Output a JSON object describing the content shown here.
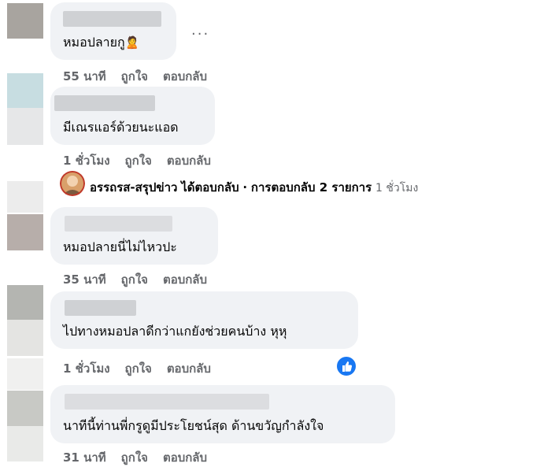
{
  "comments": [
    {
      "text": "หมอปลายกู",
      "emoji": "🙎",
      "time": "55 นาที",
      "like": "ถูกใจ",
      "reply": "ตอบกลับ",
      "more": "..."
    },
    {
      "text": "มีเณรแอร์ด้วยนะแอด",
      "time": "1 ชั่วโมง",
      "like": "ถูกใจ",
      "reply": "ตอบกลับ"
    },
    {
      "text": "หมอปลายนี่ไม่ไหวปะ",
      "time": "35 นาที",
      "like": "ถูกใจ",
      "reply": "ตอบกลับ"
    },
    {
      "text": "ไปทางหมอปลาดีกว่าแกยังช่วยคนบ้าง หุหุ",
      "time": "1 ชั่วโมง",
      "like": "ถูกใจ",
      "reply": "ตอบกลับ"
    },
    {
      "text": "นาทีนี้ท่านพี่กรูดูมีประโยชน์สุด ด้านขวัญกำลังใจ",
      "time": "31 นาที",
      "like": "ถูกใจ",
      "reply": "ตอบกลับ"
    }
  ],
  "reply_summary": {
    "name": "อรรถรส-สรุปข่าว",
    "action": "ได้ตอบกลับ",
    "separator": "·",
    "count": "การตอบกลับ 2 รายการ",
    "time": "1 ชั่วโมง"
  },
  "icons": {
    "like_badge": "thumbs-up-icon",
    "reply_avatar": "page-avatar-icon"
  },
  "colors": {
    "bubble": "#f0f2f5",
    "meta": "#65676b",
    "like": "#1877f2"
  }
}
